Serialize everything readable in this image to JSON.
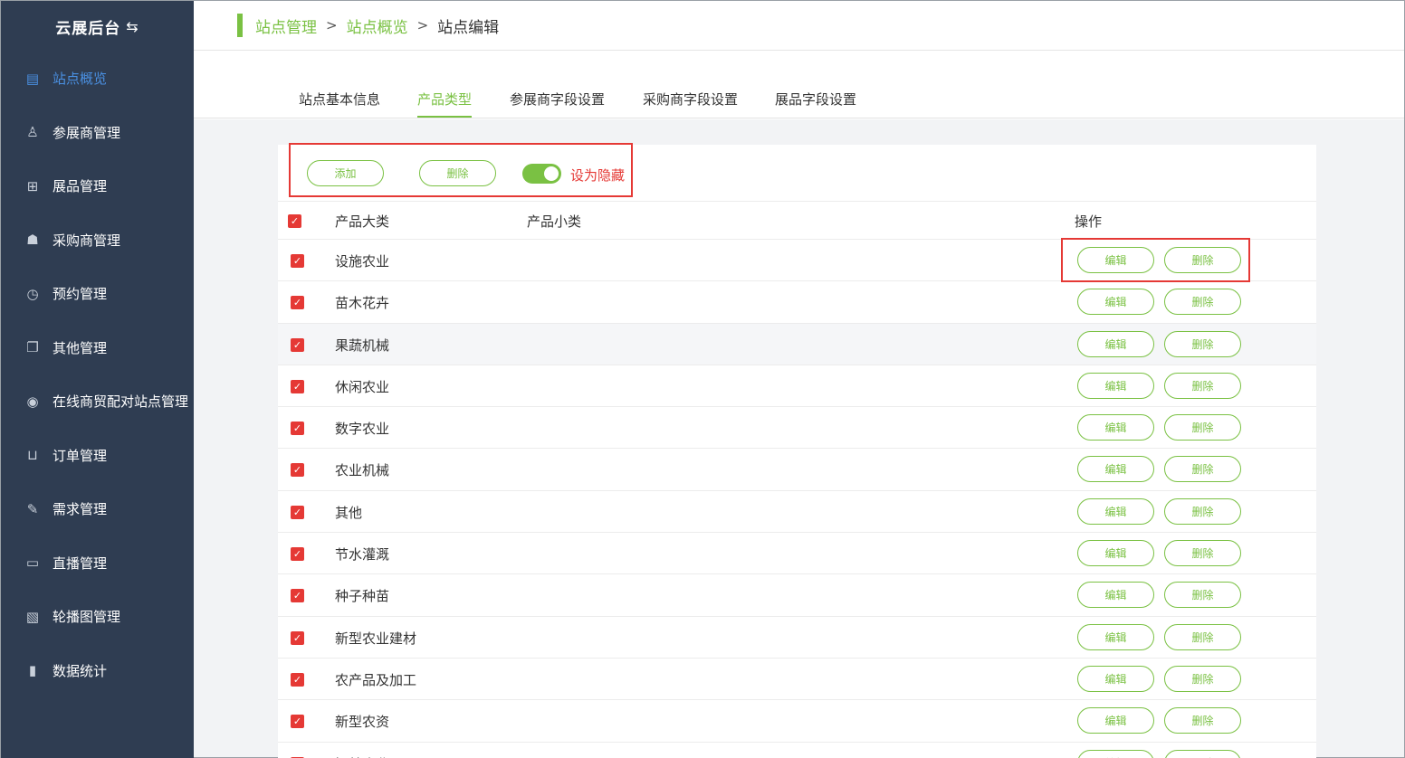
{
  "sidebar": {
    "brand": "云展后台",
    "brand_icon": "swap-icon",
    "items": [
      {
        "label": "站点概览",
        "icon": "document-icon",
        "active": true
      },
      {
        "label": "参展商管理",
        "icon": "user-icon",
        "active": false
      },
      {
        "label": "展品管理",
        "icon": "gift-icon",
        "active": false
      },
      {
        "label": "采购商管理",
        "icon": "person-icon",
        "active": false
      },
      {
        "label": "预约管理",
        "icon": "clock-icon",
        "active": false
      },
      {
        "label": "其他管理",
        "icon": "copy-icon",
        "active": false
      },
      {
        "label": "在线商贸配对站点管理",
        "icon": "eye-icon",
        "active": false
      },
      {
        "label": "订单管理",
        "icon": "cart-icon",
        "active": false
      },
      {
        "label": "需求管理",
        "icon": "edit-icon",
        "active": false
      },
      {
        "label": "直播管理",
        "icon": "video-icon",
        "active": false
      },
      {
        "label": "轮播图管理",
        "icon": "image-icon",
        "active": false
      },
      {
        "label": "数据统计",
        "icon": "bar-chart-icon",
        "active": false
      }
    ]
  },
  "breadcrumb": {
    "items": [
      "站点管理",
      "站点概览",
      "站点编辑"
    ],
    "separator": ">"
  },
  "tabs": [
    {
      "label": "站点基本信息",
      "active": false
    },
    {
      "label": "产品类型",
      "active": true
    },
    {
      "label": "参展商字段设置",
      "active": false
    },
    {
      "label": "采购商字段设置",
      "active": false
    },
    {
      "label": "展品字段设置",
      "active": false
    }
  ],
  "toolbar": {
    "add_label": "添加",
    "delete_label": "删除",
    "toggle_label": "设为隐藏",
    "toggle_on": true
  },
  "table": {
    "headers": {
      "category": "产品大类",
      "subcategory": "产品小类",
      "actions": "操作"
    },
    "edit_label": "编辑",
    "delete_label": "删除",
    "rows": [
      {
        "category": "设施农业",
        "checked": true
      },
      {
        "category": "苗木花卉",
        "checked": true
      },
      {
        "category": "果蔬机械",
        "checked": true
      },
      {
        "category": "休闲农业",
        "checked": true
      },
      {
        "category": "数字农业",
        "checked": true
      },
      {
        "category": "农业机械",
        "checked": true
      },
      {
        "category": "其他",
        "checked": true
      },
      {
        "category": "节水灌溉",
        "checked": true
      },
      {
        "category": "种子种苗",
        "checked": true
      },
      {
        "category": "新型农业建材",
        "checked": true
      },
      {
        "category": "农产品及加工",
        "checked": true
      },
      {
        "category": "新型农资",
        "checked": true
      },
      {
        "category": "智慧农业",
        "checked": true
      }
    ]
  },
  "colors": {
    "sidebar_bg": "#2f3d52",
    "accent_green": "#7ac143",
    "active_blue": "#4a90e2",
    "highlight_red": "#e53935"
  }
}
